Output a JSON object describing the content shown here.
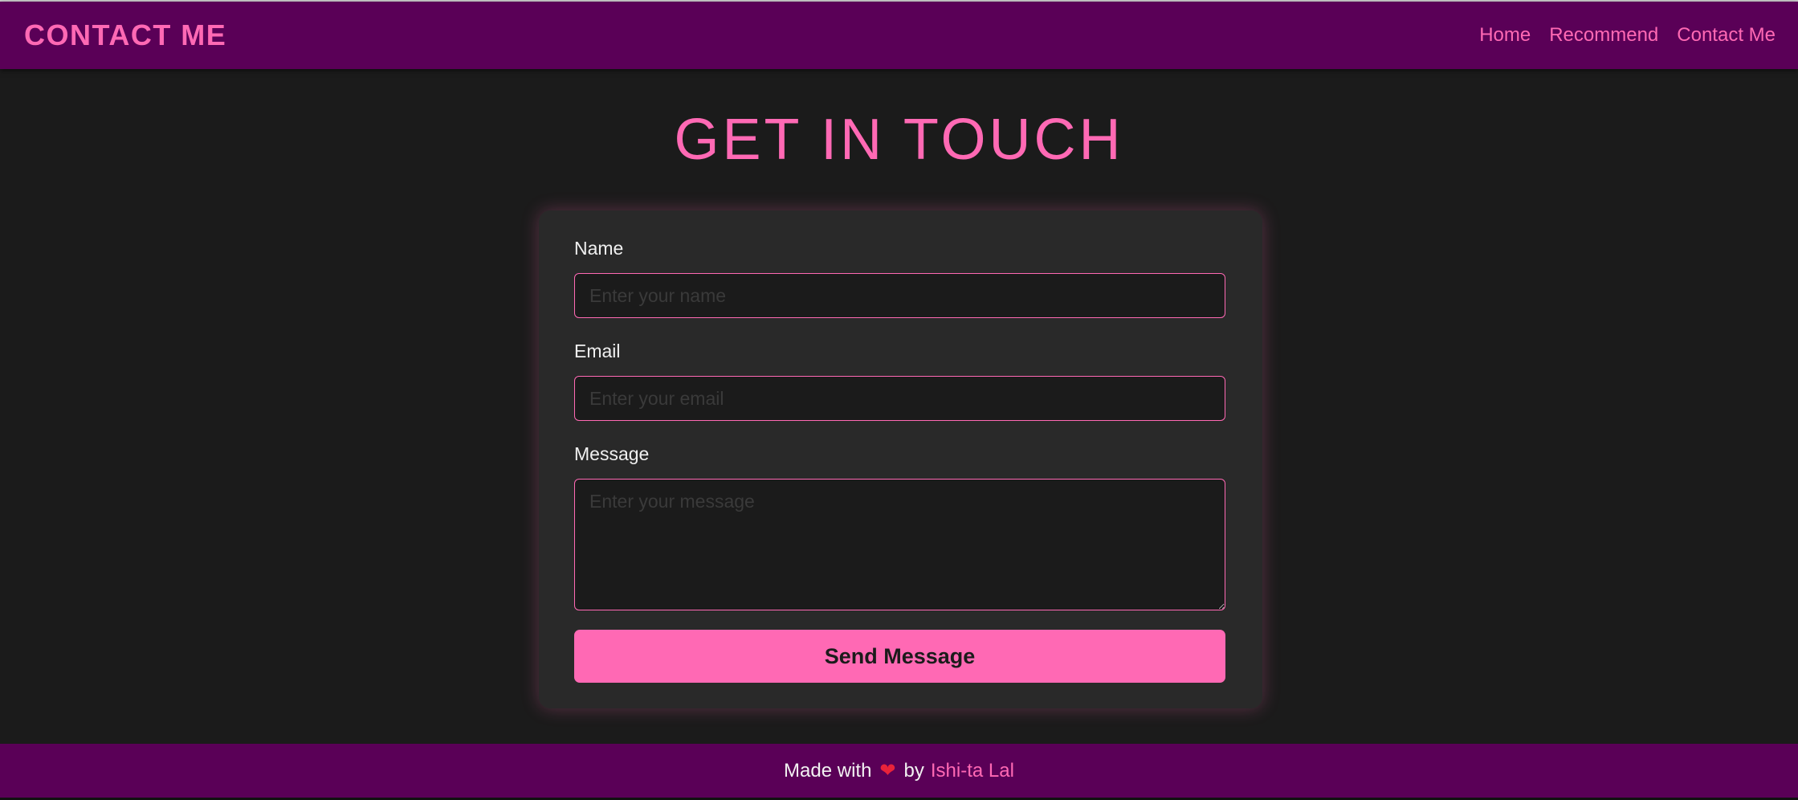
{
  "navbar": {
    "brand": "CONTACT ME",
    "links": [
      {
        "label": "Home"
      },
      {
        "label": "Recommend"
      },
      {
        "label": "Contact Me"
      }
    ]
  },
  "main": {
    "title": "GET IN TOUCH"
  },
  "form": {
    "name": {
      "label": "Name",
      "placeholder": "Enter your name",
      "value": ""
    },
    "email": {
      "label": "Email",
      "placeholder": "Enter your email",
      "value": ""
    },
    "message": {
      "label": "Message",
      "placeholder": "Enter your message",
      "value": ""
    },
    "submit_label": "Send Message"
  },
  "footer": {
    "prefix": "Made with",
    "heart_icon": "heart-icon",
    "heart_glyph": "❤",
    "by": "by",
    "author": "Ishi-ta Lal"
  },
  "colors": {
    "navbar_bg": "#5a0057",
    "accent": "#ff69b4",
    "page_bg": "#1b1b1b",
    "card_bg": "#292929"
  }
}
